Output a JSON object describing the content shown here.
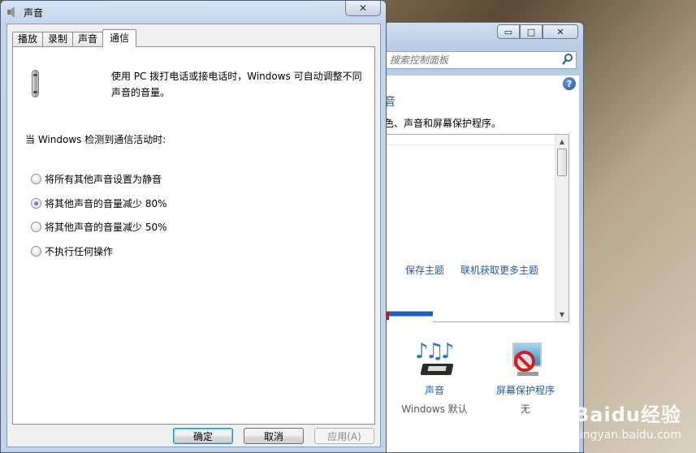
{
  "background_window": {
    "search_placeholder": "搜索控制面板",
    "heading_partial": "音",
    "desc_partial": "色、声音和屏幕保护程序。",
    "links": {
      "save_theme": "保存主题",
      "get_more_themes": "联机获取更多主题"
    },
    "items": [
      {
        "label": "声音",
        "sub": "Windows 默认",
        "icon": "sound-icon"
      },
      {
        "label": "屏幕保护程序",
        "sub": "无",
        "icon": "screensaver-icon"
      }
    ],
    "caption_buttons": {
      "minimize": "▭",
      "maximize": "□",
      "close": "✕"
    },
    "help": "?"
  },
  "dialog": {
    "title": "声音",
    "close_glyph": "✕",
    "tabs": [
      "播放",
      "录制",
      "声音",
      "通信"
    ],
    "active_tab": "通信",
    "intro": "使用 PC 拨打电话或接电话时，Windows 可自动调整不同声音的音量。",
    "detect_label": "当 Windows 检测到通信活动时:",
    "options": [
      {
        "label": "将所有其他声音设置为静音",
        "checked": false
      },
      {
        "label": "将其他声音的音量减少 80%",
        "checked": true
      },
      {
        "label": "将其他声音的音量减少 50%",
        "checked": false
      },
      {
        "label": "不执行任何操作",
        "checked": false
      }
    ],
    "buttons": {
      "ok": "确定",
      "cancel": "取消",
      "apply": "应用(A)"
    }
  },
  "watermark": {
    "main": "Baidu经验",
    "sub": "jingyan.baidu.com"
  },
  "colors": {
    "link": "#1e5aa8",
    "accent": "#1b4f9e"
  }
}
